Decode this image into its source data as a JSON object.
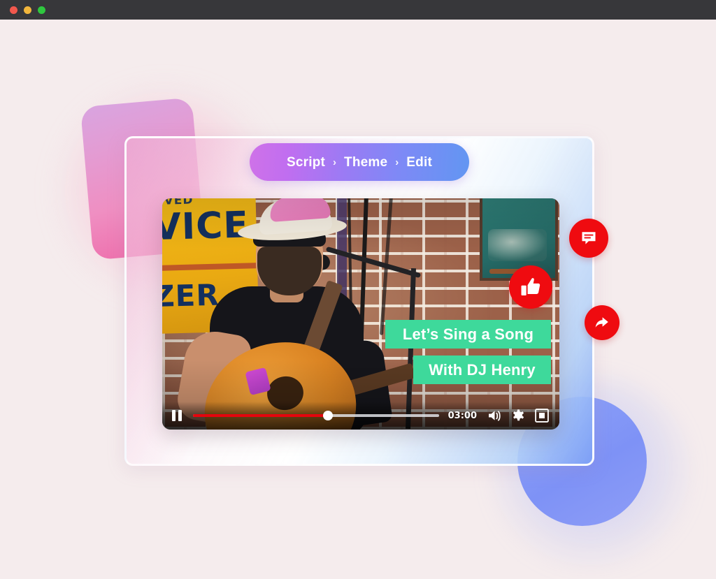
{
  "window": {
    "traffic_lights": [
      {
        "name": "close",
        "color": "#f2584d"
      },
      {
        "name": "minimize",
        "color": "#f2b63c"
      },
      {
        "name": "maximize",
        "color": "#2fc73f"
      }
    ]
  },
  "theme": {
    "background": "#f5eced",
    "accent_red": "#ef0b10",
    "caption_green": "#3ed99b",
    "progress_red": "#e5050d",
    "pill_gradient_start": "#cf72e8",
    "pill_gradient_end": "#6296f2",
    "pink_square": "#ee6aa9",
    "blue_circle": "#8fa3f9"
  },
  "breadcrumb": {
    "steps": [
      {
        "label": "Script"
      },
      {
        "label": "Theme"
      },
      {
        "label": "Edit"
      }
    ],
    "separator": "›"
  },
  "video": {
    "scene_description": "Musician in white hat with pink top, sunglasses and beard playing an acoustic guitar at a microphone in front of a brick wall",
    "sign_text": {
      "line1": "OVED",
      "line2": "VICE",
      "line3": "ZER"
    },
    "captions": [
      {
        "text": "Let’s Sing a Song"
      },
      {
        "text": "With DJ Henry"
      }
    ],
    "controls": {
      "pause_label": "Pause",
      "time": "03:00",
      "progress_percent": 55,
      "volume_label": "Volume",
      "settings_label": "Settings",
      "fullscreen_label": "Fullscreen"
    }
  },
  "social_actions": [
    {
      "name": "comment",
      "icon": "comment-icon"
    },
    {
      "name": "like",
      "icon": "thumbs-up-icon"
    },
    {
      "name": "share",
      "icon": "share-arrow-icon"
    }
  ]
}
